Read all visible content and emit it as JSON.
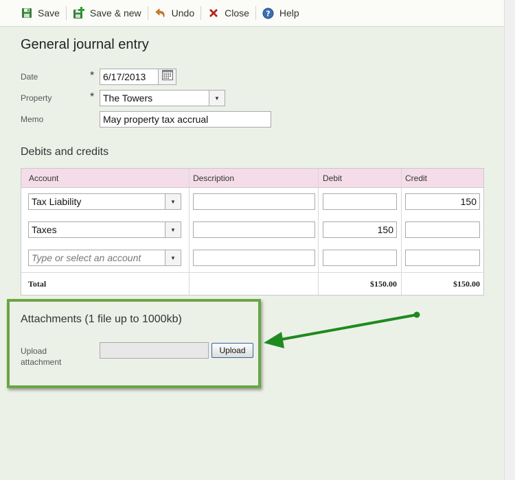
{
  "toolbar": {
    "save_label": "Save",
    "save_new_label": "Save & new",
    "undo_label": "Undo",
    "close_label": "Close",
    "help_label": "Help"
  },
  "page": {
    "title": "General journal entry"
  },
  "form": {
    "date_label": "Date",
    "date_value": "6/17/2013",
    "property_label": "Property",
    "property_value": "The Towers",
    "memo_label": "Memo",
    "memo_value": "May property tax accrual",
    "required_mark": "*"
  },
  "debits_credits": {
    "title": "Debits and credits",
    "columns": [
      "Account",
      "Description",
      "Debit",
      "Credit"
    ],
    "rows": [
      {
        "account": "Tax Liability",
        "description": "",
        "debit": "",
        "credit": "150"
      },
      {
        "account": "Taxes",
        "description": "",
        "debit": "150",
        "credit": ""
      },
      {
        "account": "",
        "account_placeholder": "Type or select an account",
        "description": "",
        "debit": "",
        "credit": ""
      }
    ],
    "total_label": "Total",
    "total_debit": "$150.00",
    "total_credit": "$150.00"
  },
  "attachments": {
    "title": "Attachments (1 file up to 1000kb)",
    "upload_label": "Upload attachment",
    "upload_button": "Upload"
  },
  "colors": {
    "highlight_green": "#6aa544",
    "arrow_green": "#1f8a1f",
    "grid_header": "#f4dde8"
  }
}
